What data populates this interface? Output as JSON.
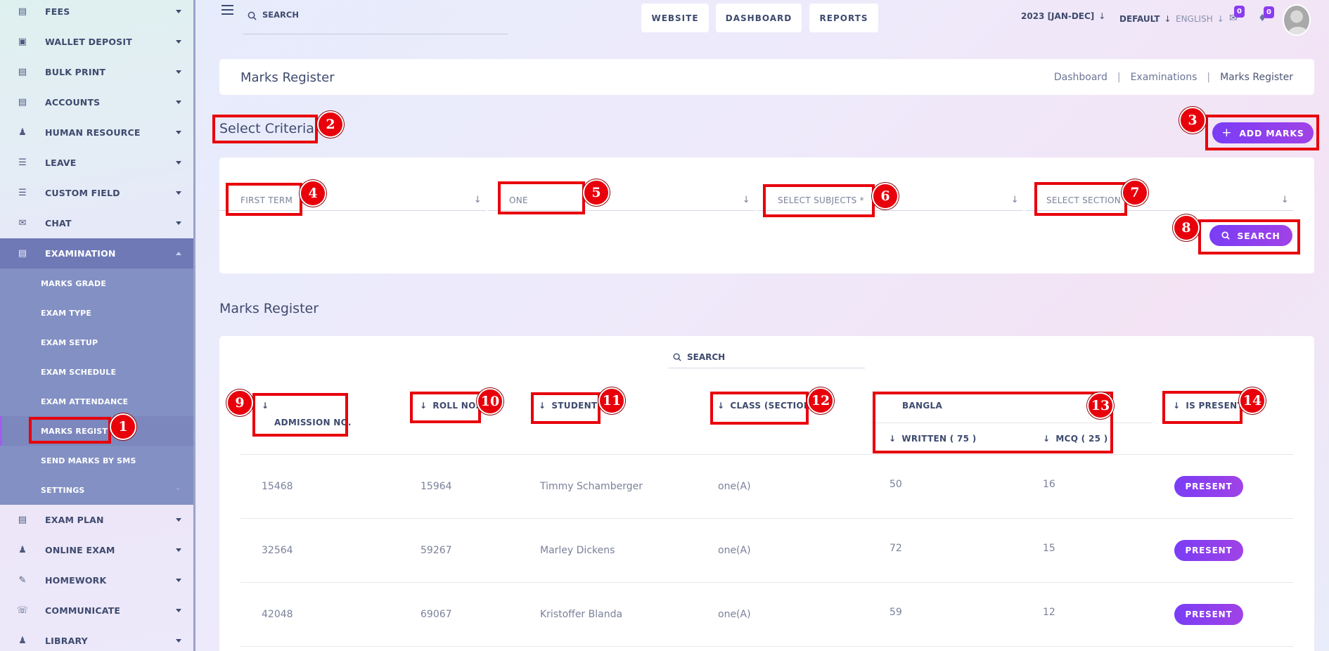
{
  "sidebar": {
    "items_top": [
      {
        "label": "FEES",
        "icon": "receipt-icon"
      },
      {
        "label": "WALLET DEPOSIT",
        "icon": "wallet-icon"
      },
      {
        "label": "BULK PRINT",
        "icon": "print-icon"
      },
      {
        "label": "ACCOUNTS",
        "icon": "accounts-icon"
      },
      {
        "label": "HUMAN RESOURCE",
        "icon": "user-tie-icon"
      },
      {
        "label": "LEAVE",
        "icon": "bed-icon"
      },
      {
        "label": "CUSTOM FIELD",
        "icon": "bed-icon"
      },
      {
        "label": "CHAT",
        "icon": "chat-icon"
      }
    ],
    "active_item": {
      "label": "EXAMINATION",
      "icon": "document-icon"
    },
    "submenu": [
      {
        "label": "MARKS GRADE"
      },
      {
        "label": "EXAM TYPE"
      },
      {
        "label": "EXAM SETUP"
      },
      {
        "label": "EXAM SCHEDULE"
      },
      {
        "label": "EXAM ATTENDANCE"
      },
      {
        "label": "MARKS REGISTER",
        "active": true
      },
      {
        "label": "SEND MARKS BY SMS"
      },
      {
        "label": "SETTINGS"
      }
    ],
    "items_bottom": [
      {
        "label": "EXAM PLAN",
        "icon": "document-icon"
      },
      {
        "label": "ONLINE EXAM",
        "icon": "laptop-user-icon"
      },
      {
        "label": "HOMEWORK",
        "icon": "homework-icon"
      },
      {
        "label": "COMMUNICATE",
        "icon": "communicate-icon"
      },
      {
        "label": "LIBRARY",
        "icon": "library-icon"
      }
    ]
  },
  "topbar": {
    "search_placeholder": "SEARCH",
    "buttons": [
      "WEBSITE",
      "DASHBOARD",
      "REPORTS"
    ],
    "session": "2023 [JAN-DEC]",
    "theme": "DEFAULT",
    "language": "ENGLISH",
    "messages_count": "0",
    "notifications_count": "0"
  },
  "page": {
    "title": "Marks Register",
    "breadcrumb": [
      "Dashboard",
      "Examinations",
      "Marks Register"
    ]
  },
  "criteria": {
    "title": "Select Criteria",
    "add_marks_label": "ADD MARKS",
    "fields": [
      {
        "value": "FIRST TERM"
      },
      {
        "value": "ONE"
      },
      {
        "value": "SELECT SUBJECTS *"
      },
      {
        "value": "SELECT SECTION"
      }
    ],
    "search_label": "SEARCH"
  },
  "register": {
    "title": "Marks Register",
    "search_placeholder": "SEARCH",
    "columns": {
      "admission": "ADMISSION NO.",
      "roll": "ROLL NO.",
      "student": "STUDENT",
      "class": "CLASS (SECTION)",
      "subject": "BANGLA",
      "written": "WRITTEN ( 75 )",
      "mcq": "MCQ ( 25 )",
      "present": "IS PRESENT"
    },
    "rows": [
      {
        "admission": "15468",
        "roll": "15964",
        "student": "Timmy Schamberger",
        "class": "one(A)",
        "written": "50",
        "mcq": "16",
        "status": "PRESENT"
      },
      {
        "admission": "32564",
        "roll": "59267",
        "student": "Marley Dickens",
        "class": "one(A)",
        "written": "72",
        "mcq": "15",
        "status": "PRESENT"
      },
      {
        "admission": "42048",
        "roll": "69067",
        "student": "Kristoffer Blanda",
        "class": "one(A)",
        "written": "59",
        "mcq": "12",
        "status": "PRESENT"
      }
    ]
  },
  "annotations": [
    "1",
    "2",
    "3",
    "4",
    "5",
    "6",
    "7",
    "8",
    "9",
    "10",
    "11",
    "12",
    "13",
    "14"
  ],
  "colors": {
    "accent": "#8a3cf0",
    "annotation_red": "#e8000b",
    "sidebar_active": "#6f79b5",
    "submenu_bg": "#8390c3"
  }
}
